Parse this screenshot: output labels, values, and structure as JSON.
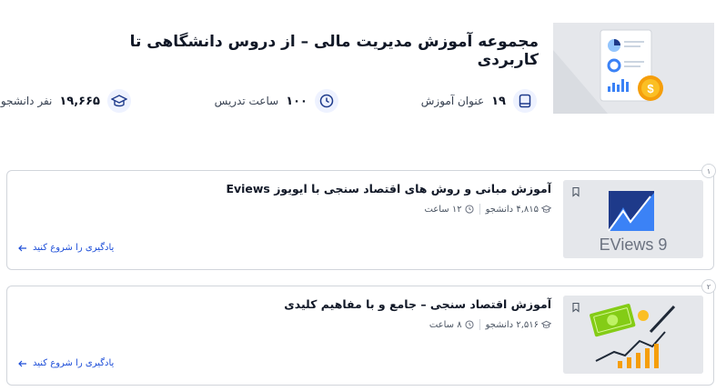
{
  "header": {
    "title": "مجموعه آموزش مدیریت مالی – از دروس دانشگاهی تا کاربردی",
    "stats": {
      "lessons": {
        "value": "۱۹",
        "label": "عنوان آموزش"
      },
      "hours": {
        "value": "۱۰۰",
        "label": "ساعت تدریس"
      },
      "students": {
        "value": "۱۹,۶۶۵",
        "label": "نفر دانشجو"
      }
    }
  },
  "courses": [
    {
      "index": "۱",
      "title": "آموزش مبانی و روش های اقتصاد سنجی با ایویوز Eviews",
      "students": "۴,۸۱۵ دانشجو",
      "hours": "۱۲ ساعت",
      "cta": "یادگیری را شروع کنید",
      "thumb_text": "EViews 9"
    },
    {
      "index": "۲",
      "title": "آموزش اقتصاد سنجی – جامع و با مفاهیم کلیدی",
      "students": "۲,۵۱۶ دانشجو",
      "hours": "۸ ساعت",
      "cta": "یادگیری را شروع کنید"
    }
  ],
  "colors": {
    "accent": "#1d4ed8",
    "icon": "#1e3a8a",
    "border": "#d1d5db"
  }
}
